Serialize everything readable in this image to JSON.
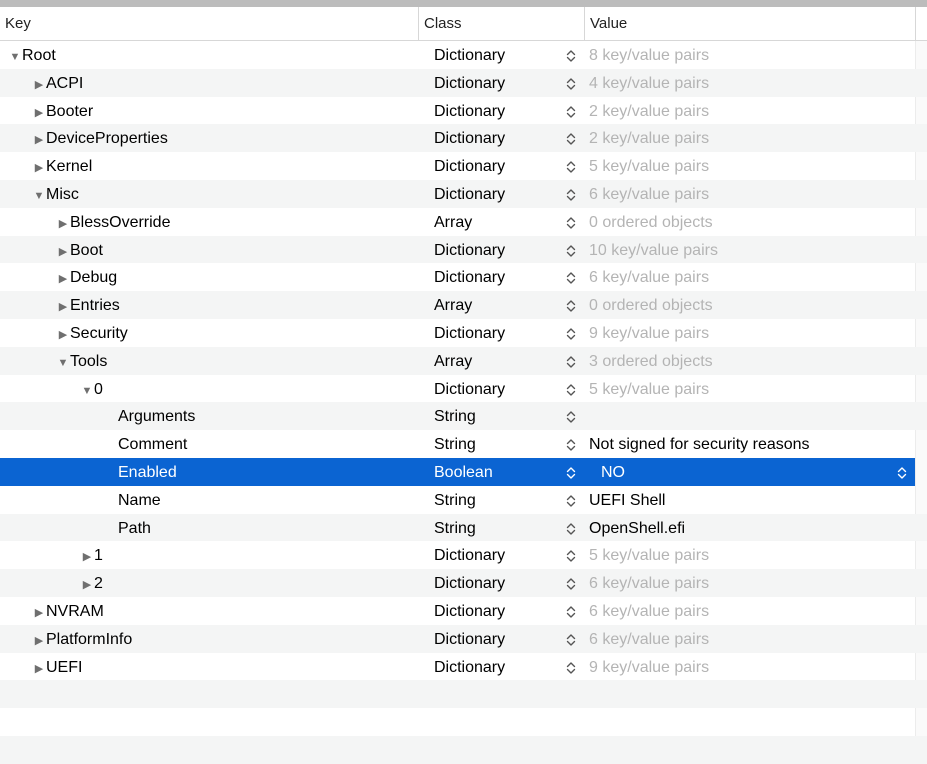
{
  "columns": {
    "key": "Key",
    "class": "Class",
    "value": "Value"
  },
  "rows": [
    {
      "key": "Root",
      "level": 0,
      "toggle": "expanded",
      "class": "Dictionary",
      "value": "8 key/value pairs",
      "muted": true
    },
    {
      "key": "ACPI",
      "level": 1,
      "toggle": "collapsed",
      "class": "Dictionary",
      "value": "4 key/value pairs",
      "muted": true
    },
    {
      "key": "Booter",
      "level": 1,
      "toggle": "collapsed",
      "class": "Dictionary",
      "value": "2 key/value pairs",
      "muted": true
    },
    {
      "key": "DeviceProperties",
      "level": 1,
      "toggle": "collapsed",
      "class": "Dictionary",
      "value": "2 key/value pairs",
      "muted": true
    },
    {
      "key": "Kernel",
      "level": 1,
      "toggle": "collapsed",
      "class": "Dictionary",
      "value": "5 key/value pairs",
      "muted": true
    },
    {
      "key": "Misc",
      "level": 1,
      "toggle": "expanded",
      "class": "Dictionary",
      "value": "6 key/value pairs",
      "muted": true
    },
    {
      "key": "BlessOverride",
      "level": 2,
      "toggle": "collapsed",
      "class": "Array",
      "value": "0 ordered objects",
      "muted": true
    },
    {
      "key": "Boot",
      "level": 2,
      "toggle": "collapsed",
      "class": "Dictionary",
      "value": "10 key/value pairs",
      "muted": true
    },
    {
      "key": "Debug",
      "level": 2,
      "toggle": "collapsed",
      "class": "Dictionary",
      "value": "6 key/value pairs",
      "muted": true
    },
    {
      "key": "Entries",
      "level": 2,
      "toggle": "collapsed",
      "class": "Array",
      "value": "0 ordered objects",
      "muted": true
    },
    {
      "key": "Security",
      "level": 2,
      "toggle": "collapsed",
      "class": "Dictionary",
      "value": "9 key/value pairs",
      "muted": true
    },
    {
      "key": "Tools",
      "level": 2,
      "toggle": "expanded",
      "class": "Array",
      "value": "3 ordered objects",
      "muted": true
    },
    {
      "key": "0",
      "level": 3,
      "toggle": "expanded",
      "class": "Dictionary",
      "value": "5 key/value pairs",
      "muted": true
    },
    {
      "key": "Arguments",
      "level": 5,
      "toggle": "none",
      "class": "String",
      "value": "",
      "muted": false
    },
    {
      "key": "Comment",
      "level": 5,
      "toggle": "none",
      "class": "String",
      "value": "Not signed for security reasons",
      "muted": false
    },
    {
      "key": "Enabled",
      "level": 5,
      "toggle": "none",
      "class": "Boolean",
      "value": "NO",
      "muted": false,
      "selected": true
    },
    {
      "key": "Name",
      "level": 5,
      "toggle": "none",
      "class": "String",
      "value": "UEFI Shell",
      "muted": false
    },
    {
      "key": "Path",
      "level": 5,
      "toggle": "none",
      "class": "String",
      "value": "OpenShell.efi",
      "muted": false
    },
    {
      "key": "1",
      "level": 3,
      "toggle": "collapsed",
      "class": "Dictionary",
      "value": "5 key/value pairs",
      "muted": true
    },
    {
      "key": "2",
      "level": 3,
      "toggle": "collapsed",
      "class": "Dictionary",
      "value": "6 key/value pairs",
      "muted": true
    },
    {
      "key": "NVRAM",
      "level": 1,
      "toggle": "collapsed",
      "class": "Dictionary",
      "value": "6 key/value pairs",
      "muted": true
    },
    {
      "key": "PlatformInfo",
      "level": 1,
      "toggle": "collapsed",
      "class": "Dictionary",
      "value": "6 key/value pairs",
      "muted": true
    },
    {
      "key": "UEFI",
      "level": 1,
      "toggle": "collapsed",
      "class": "Dictionary",
      "value": "9 key/value pairs",
      "muted": true
    }
  ],
  "colors": {
    "selection": "#0b64d2",
    "muted_text": "#b4b4b4",
    "alt_row": "#f4f5f5"
  },
  "icons": {
    "expanded": "disclosure-triangle-down-icon",
    "collapsed": "disclosure-triangle-right-icon",
    "stepper": "up-down-stepper-icon"
  }
}
